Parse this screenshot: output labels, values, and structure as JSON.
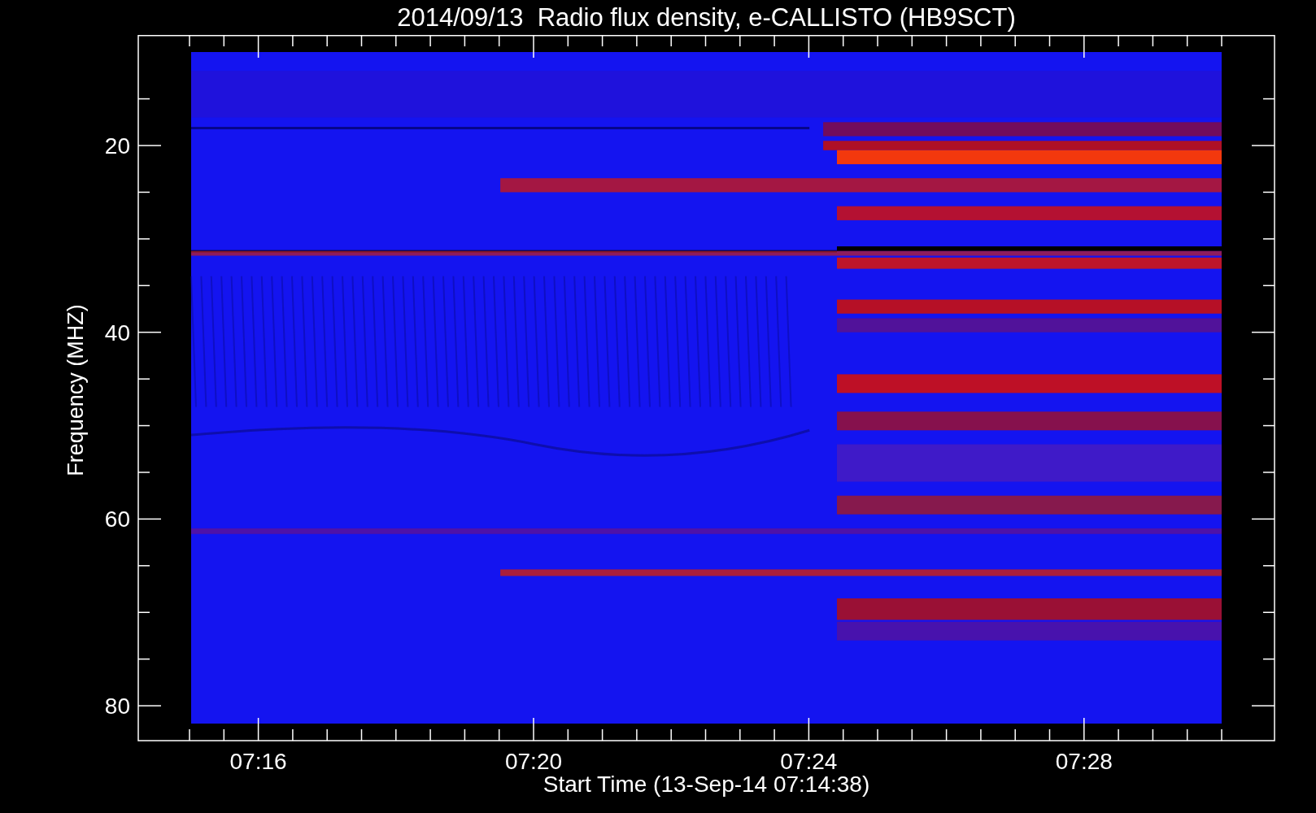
{
  "title": "2014/09/13  Radio flux density, e-CALLISTO (HB9SCT)",
  "plot": {
    "ylabel": "Frequency (MHZ)",
    "yticks": [
      "20",
      "40",
      "60",
      "80"
    ],
    "xticks": [
      "07:16",
      "07:20",
      "07:24",
      "07:28"
    ],
    "xlabel": "Start Time (13-Sep-14 07:14:38)"
  }
}
